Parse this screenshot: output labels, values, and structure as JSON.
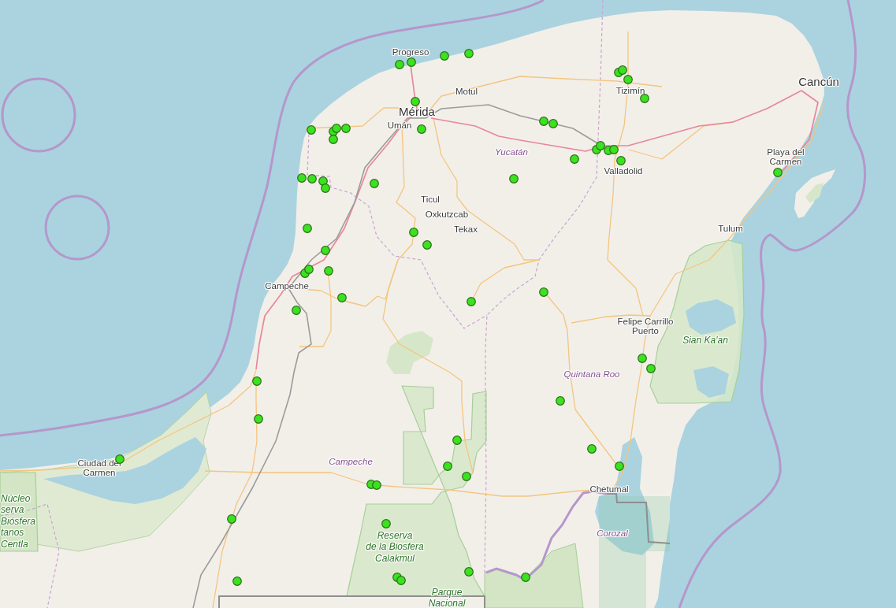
{
  "map": {
    "labels": [
      {
        "kind": "city",
        "lines": [
          "Progreso"
        ]
      },
      {
        "kind": "city",
        "lines": [
          "Motul"
        ]
      },
      {
        "kind": "major-city",
        "lines": [
          "Mérida"
        ]
      },
      {
        "kind": "city",
        "lines": [
          "Umán"
        ]
      },
      {
        "kind": "city",
        "lines": [
          "Tizimín"
        ]
      },
      {
        "kind": "major-city",
        "lines": [
          "Cancún"
        ]
      },
      {
        "kind": "region",
        "lines": [
          "Yucatán"
        ]
      },
      {
        "kind": "city",
        "lines": [
          "Valladolid"
        ]
      },
      {
        "kind": "city",
        "lines": [
          "Playa del",
          "Carmen"
        ]
      },
      {
        "kind": "city",
        "lines": [
          "Ticul"
        ]
      },
      {
        "kind": "city",
        "lines": [
          "Oxkutzcab"
        ]
      },
      {
        "kind": "city",
        "lines": [
          "Tekax"
        ]
      },
      {
        "kind": "city",
        "lines": [
          "Tulum"
        ]
      },
      {
        "kind": "city",
        "lines": [
          "Campeche"
        ]
      },
      {
        "kind": "city",
        "lines": [
          "Felipe Carrillo",
          "Puerto"
        ]
      },
      {
        "kind": "park",
        "lines": [
          "Sian Ka'an"
        ]
      },
      {
        "kind": "region",
        "lines": [
          "Quintana Roo"
        ]
      },
      {
        "kind": "city",
        "lines": [
          "Ciudad del",
          "Carmen"
        ]
      },
      {
        "kind": "region",
        "lines": [
          "Campeche"
        ]
      },
      {
        "kind": "city",
        "lines": [
          "Chetumal"
        ]
      },
      {
        "kind": "region",
        "lines": [
          "Corozal"
        ]
      },
      {
        "kind": "park",
        "lines": [
          "Reserva",
          "de la Biosfera",
          "Calakmul"
        ]
      },
      {
        "kind": "park",
        "lines": [
          "Núcleo",
          "serva",
          "Biósfera",
          "tanos",
          "Centla"
        ]
      },
      {
        "kind": "park",
        "lines": [
          "Parque",
          "Nacional"
        ]
      }
    ]
  }
}
